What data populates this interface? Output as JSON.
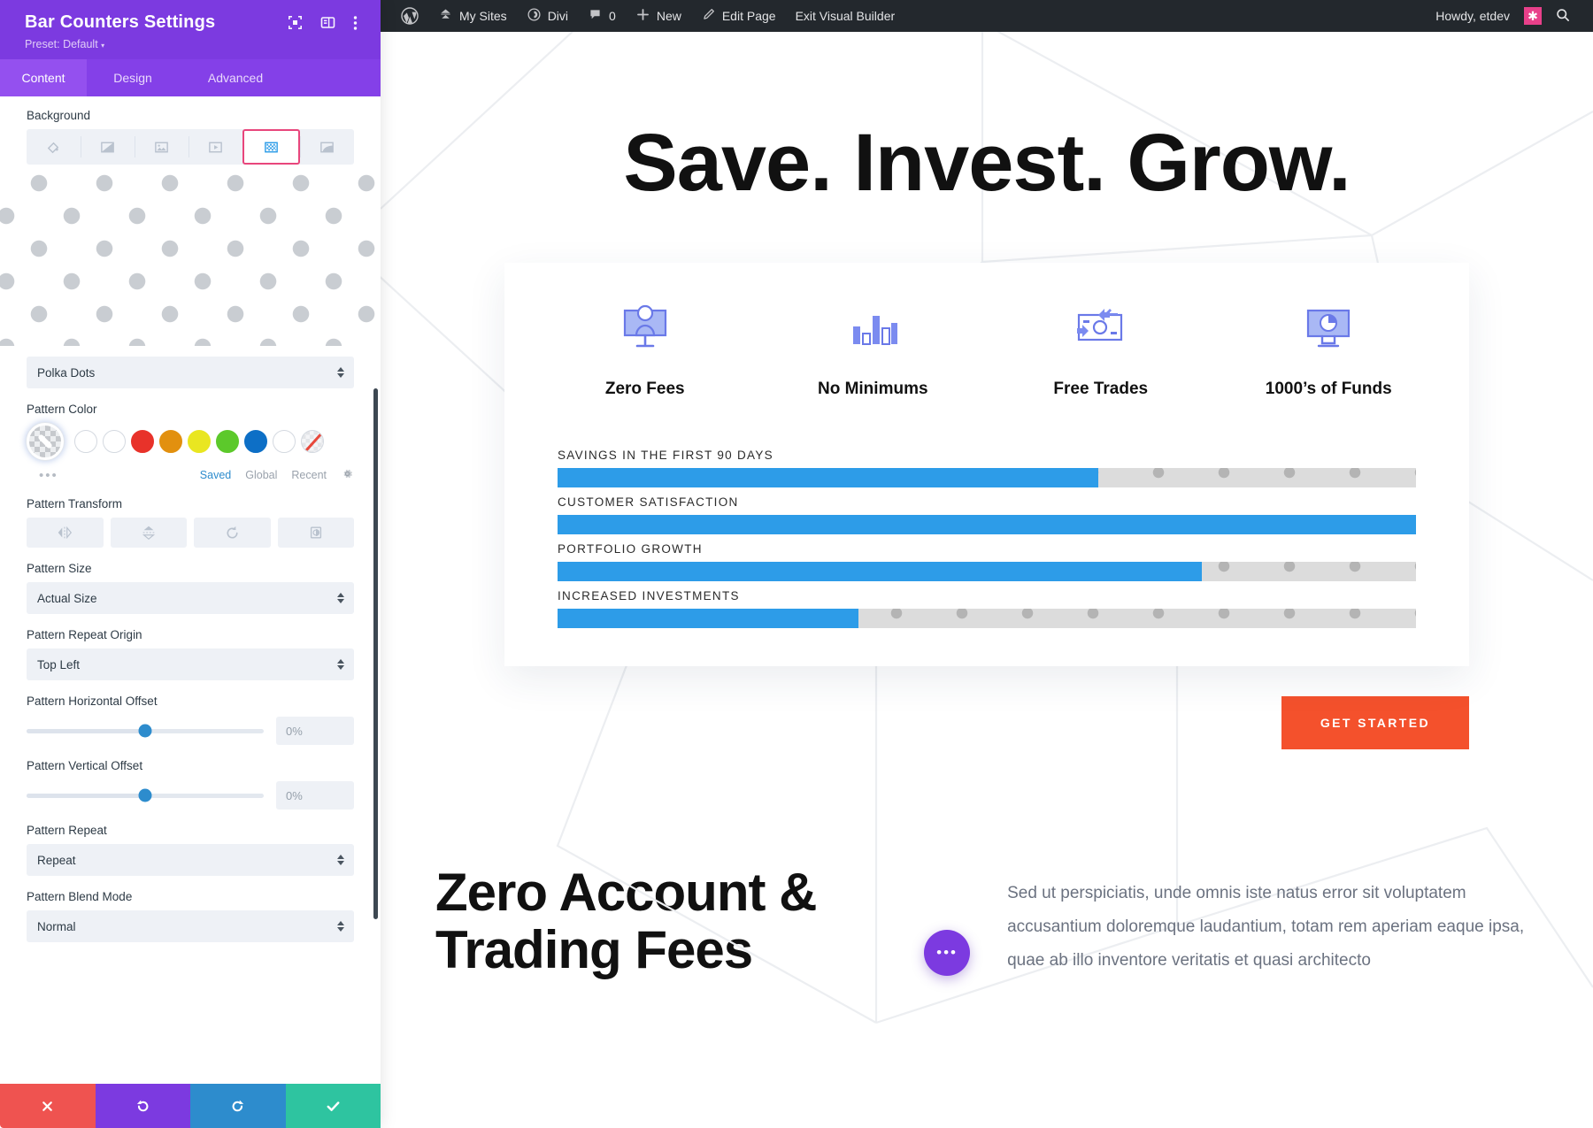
{
  "settings_panel": {
    "title": "Bar Counters Settings",
    "preset": "Preset: Default",
    "header_icons": [
      "focus-target-icon",
      "panel-layout-icon",
      "more-vertical-icon"
    ],
    "tabs": [
      {
        "label": "Content",
        "active": true
      },
      {
        "label": "Design",
        "active": false
      },
      {
        "label": "Advanced",
        "active": false
      }
    ],
    "background": {
      "label": "Background",
      "types": [
        {
          "name": "background-color",
          "selected": false
        },
        {
          "name": "background-gradient",
          "selected": false
        },
        {
          "name": "background-image",
          "selected": false
        },
        {
          "name": "background-video",
          "selected": false
        },
        {
          "name": "background-pattern",
          "selected": true
        },
        {
          "name": "background-mask",
          "selected": false
        }
      ]
    },
    "pattern_style": {
      "label": "",
      "value": "Polka Dots"
    },
    "pattern_color": {
      "label": "Pattern Color",
      "swatches": [
        {
          "name": "color-picker",
          "color": "transparent"
        },
        {
          "name": "swatch-white-1",
          "color": "#ffffff"
        },
        {
          "name": "swatch-white-2",
          "color": "#ffffff"
        },
        {
          "name": "swatch-red",
          "color": "#e8322a"
        },
        {
          "name": "swatch-orange",
          "color": "#e2900f"
        },
        {
          "name": "swatch-yellow",
          "color": "#e9e621"
        },
        {
          "name": "swatch-green",
          "color": "#5cc92b"
        },
        {
          "name": "swatch-blue",
          "color": "#0d6fc6"
        },
        {
          "name": "swatch-white-3",
          "color": "#ffffff"
        },
        {
          "name": "swatch-none",
          "color": "none"
        }
      ],
      "dots": "•••",
      "links": [
        {
          "label": "Saved",
          "active": true
        },
        {
          "label": "Global",
          "active": false
        },
        {
          "label": "Recent",
          "active": false
        }
      ],
      "gear": "gear-icon"
    },
    "pattern_transform": {
      "label": "Pattern Transform",
      "buttons": [
        "flip-horizontal-icon",
        "flip-vertical-icon",
        "rotate-icon",
        "invert-icon"
      ]
    },
    "pattern_size": {
      "label": "Pattern Size",
      "value": "Actual Size"
    },
    "pattern_repeat_origin": {
      "label": "Pattern Repeat Origin",
      "value": "Top Left"
    },
    "pattern_horizontal_offset": {
      "label": "Pattern Horizontal Offset",
      "value": "0%"
    },
    "pattern_vertical_offset": {
      "label": "Pattern Vertical Offset",
      "value": "0%"
    },
    "pattern_repeat": {
      "label": "Pattern Repeat",
      "value": "Repeat"
    },
    "pattern_blend_mode": {
      "label": "Pattern Blend Mode",
      "value": "Normal"
    },
    "actions": [
      {
        "name": "cancel-button",
        "icon": "close-icon",
        "color": "#ef5350"
      },
      {
        "name": "undo-button",
        "icon": "undo-icon",
        "color": "#7c3ae0"
      },
      {
        "name": "redo-button",
        "icon": "redo-icon",
        "color": "#2d8ccd"
      },
      {
        "name": "save-button",
        "icon": "check-icon",
        "color": "#2ec4a0"
      }
    ]
  },
  "admin_bar": {
    "items": [
      {
        "label": "",
        "icon": "wordpress-icon"
      },
      {
        "label": "My Sites",
        "icon": "sites-icon"
      },
      {
        "label": "Divi",
        "icon": "divi-icon"
      },
      {
        "label": "0",
        "icon": "comment-icon"
      },
      {
        "label": "New",
        "icon": "plus-icon"
      },
      {
        "label": "Edit Page",
        "icon": "pencil-icon"
      },
      {
        "label": "Exit Visual Builder",
        "icon": ""
      }
    ],
    "howdy": "Howdy, etdev",
    "avatar_icon": "avatar-icon",
    "search_icon": "search-icon"
  },
  "page": {
    "hero_title": "Save. Invest. Grow.",
    "features": [
      {
        "label": "Zero Fees",
        "icon": "monitor-person-icon"
      },
      {
        "label": "No Minimums",
        "icon": "bar-chart-icon"
      },
      {
        "label": "Free Trades",
        "icon": "money-transfer-icon"
      },
      {
        "label": "1000’s of Funds",
        "icon": "monitor-pie-chart-icon"
      }
    ],
    "cta_label": "GET STARTED",
    "bottom_title": "Zero Account & Trading Fees",
    "bottom_paragraph": "Sed ut perspiciatis, unde omnis iste natus error sit voluptatem accusantium doloremque laudantium, totam rem aperiam eaque ipsa, quae ab illo inventore veritatis et quasi architecto",
    "fab_label": "•••",
    "bar_color": "#2d9ce8",
    "track_color": "#dcdcdc",
    "cta_color": "#f4512c"
  },
  "chart_data": {
    "type": "bar",
    "title": "",
    "orientation": "horizontal",
    "categories": [
      "SAVINGS IN THE FIRST 90 DAYS",
      "CUSTOMER SATISFACTION",
      "PORTFOLIO GROWTH",
      "INCREASED INVESTMENTS"
    ],
    "values": [
      63,
      100,
      75,
      35
    ],
    "xlabel": "",
    "ylabel": "",
    "xlim": [
      0,
      100
    ],
    "unit": "%",
    "grid": false,
    "legend": false
  }
}
